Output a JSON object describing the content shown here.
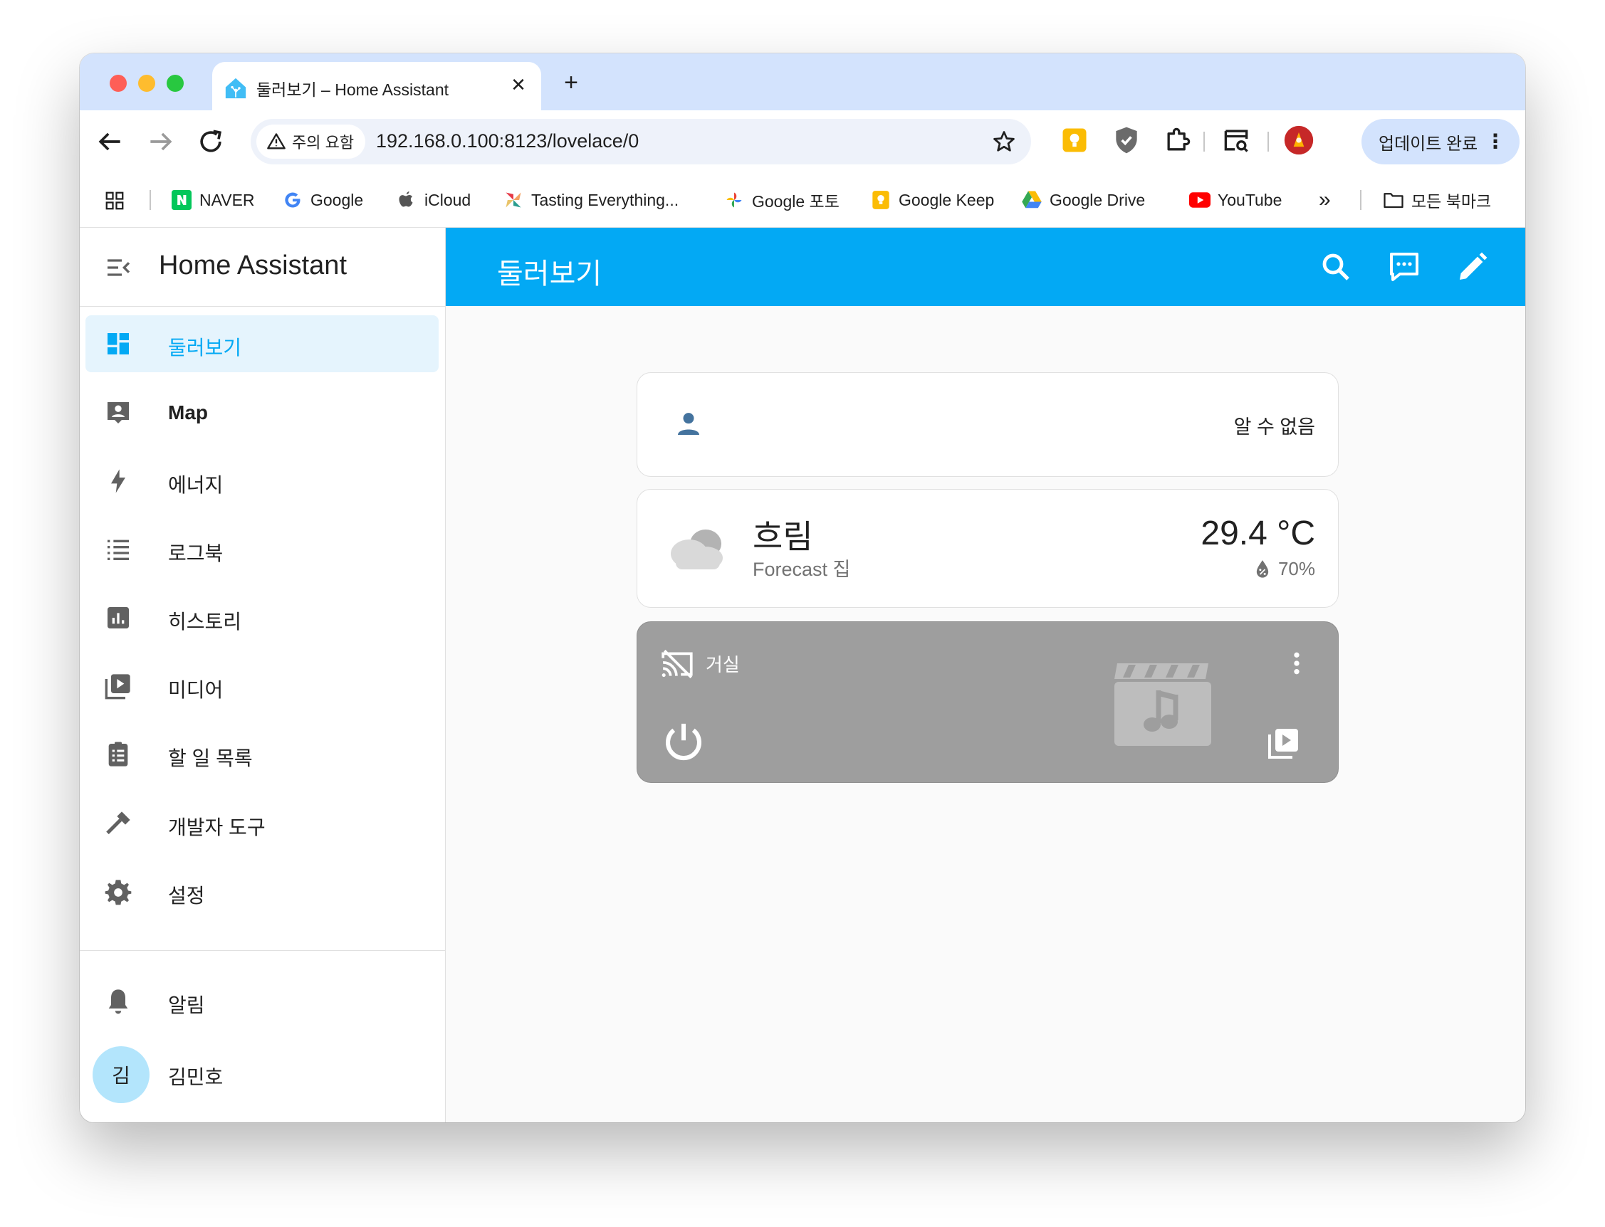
{
  "browser": {
    "tab_title": "둘러보기 – Home Assistant",
    "tab_close_glyph": "✕",
    "new_tab_glyph": "+",
    "security_label": "주의 요함",
    "url": "192.168.0.100:8123/lovelace/0",
    "update_label": "업데이트 완료",
    "update_menu_glyph": "⋮",
    "bookmarks_overflow_glyph": "»",
    "bookmarks": [
      {
        "label": "NAVER",
        "icon": "naver-icon",
        "color": "#03c75a"
      },
      {
        "label": "Google",
        "icon": "google-icon",
        "color": "#4285f4"
      },
      {
        "label": "iCloud",
        "icon": "apple-icon",
        "color": "#555555"
      },
      {
        "label": "Tasting Everything...",
        "icon": "pinwheel-icon",
        "color": "#e76f51"
      },
      {
        "label": "Google 포토",
        "icon": "google-photos-icon",
        "color": "#fbbc04"
      },
      {
        "label": "Google Keep",
        "icon": "google-keep-icon",
        "color": "#fbbc04"
      },
      {
        "label": "Google Drive",
        "icon": "google-drive-icon",
        "color": "#34a853"
      },
      {
        "label": "YouTube",
        "icon": "youtube-icon",
        "color": "#ff0000"
      }
    ],
    "all_bookmarks_label": "모든 북마크"
  },
  "sidebar": {
    "title": "Home Assistant",
    "items": [
      {
        "label": "둘러보기",
        "icon": "dashboard-icon",
        "active": true
      },
      {
        "label": "Map",
        "icon": "map-icon"
      },
      {
        "label": "에너지",
        "icon": "lightning-icon"
      },
      {
        "label": "로그북",
        "icon": "logbook-icon"
      },
      {
        "label": "히스토리",
        "icon": "chart-icon"
      },
      {
        "label": "미디어",
        "icon": "media-icon"
      },
      {
        "label": "할 일 목록",
        "icon": "clipboard-list-icon"
      },
      {
        "label": "개발자 도구",
        "icon": "hammer-icon"
      },
      {
        "label": "설정",
        "icon": "gear-icon"
      }
    ],
    "notifications_label": "알림",
    "user": {
      "initial": "김",
      "name": "김민호"
    }
  },
  "main": {
    "title": "둘러보기",
    "accent": "#03a9f4",
    "person_card": {
      "state": "알 수 없음"
    },
    "weather_card": {
      "condition": "흐림",
      "name": "Forecast 집",
      "temperature": "29.4 °C",
      "humidity": "70%"
    },
    "media_card": {
      "name": "거실",
      "more_glyph": "⋮"
    }
  }
}
